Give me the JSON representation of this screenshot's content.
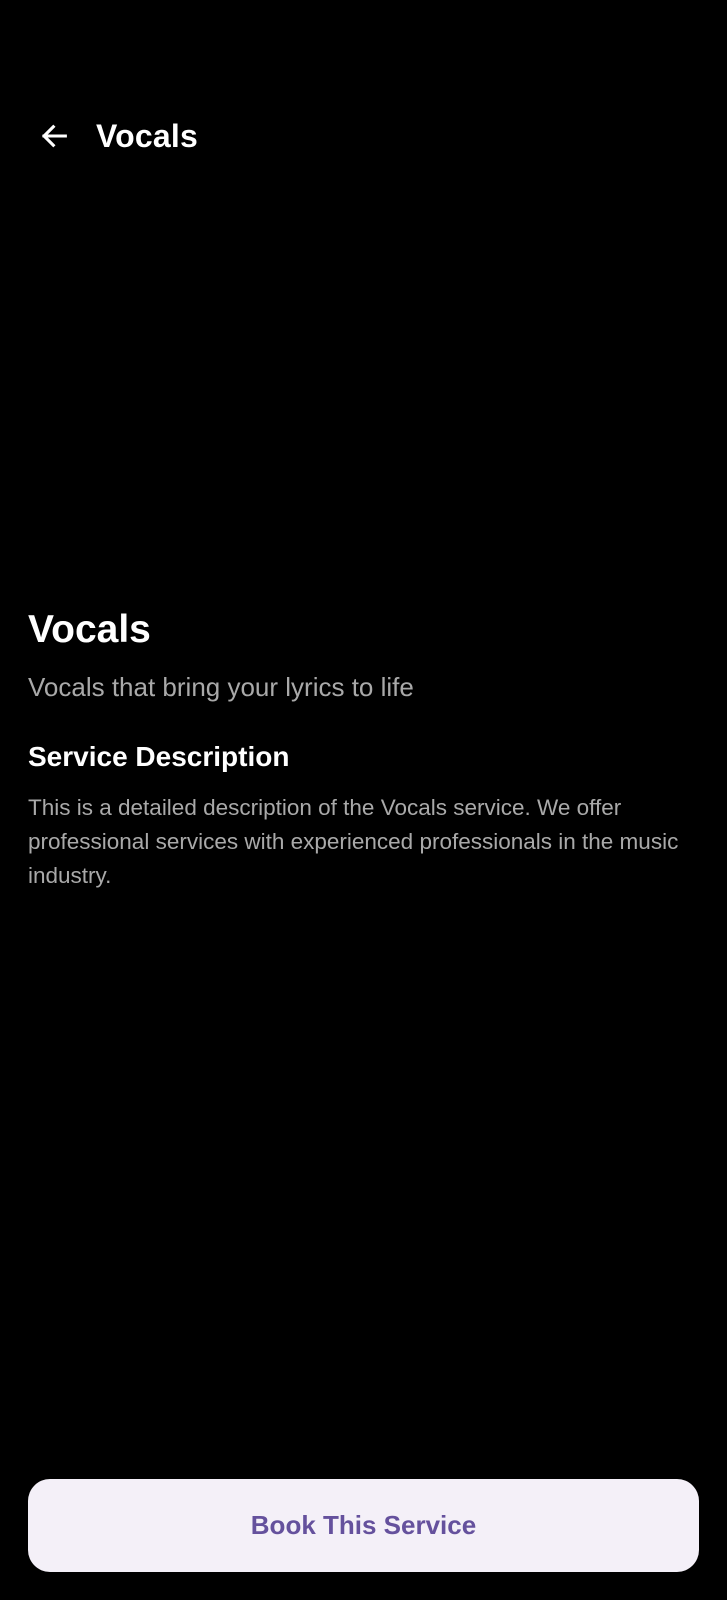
{
  "app_bar": {
    "back_icon": "arrow-left-icon",
    "title": "Vocals"
  },
  "service": {
    "title": "Vocals",
    "tagline": "Vocals that bring your lyrics to life",
    "description_heading": "Service Description",
    "description": "This is a detailed description of the Vocals service. We offer professional services with experienced professionals in the music industry."
  },
  "actions": {
    "book_label": "Book This Service"
  },
  "colors": {
    "background": "#000000",
    "text_primary": "#ffffff",
    "text_secondary": "#a9a9a9",
    "button_background": "#f4f0f8",
    "button_text": "#65519d"
  }
}
